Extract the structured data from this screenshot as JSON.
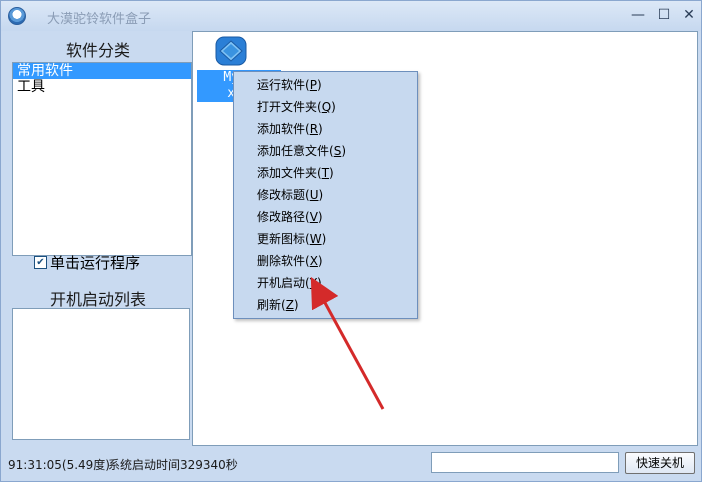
{
  "window": {
    "title": "大漠驼铃软件盒子"
  },
  "controls": {
    "minimize": "—",
    "maximize": "☐",
    "close": "✕"
  },
  "left": {
    "category_title": "软件分类",
    "categories": [
      {
        "label": "常用软件",
        "selected": true
      },
      {
        "label": "工具",
        "selected": false
      }
    ],
    "single_click_label": "单击运行程序",
    "single_click_checked": true,
    "startup_title": "开机启动列表"
  },
  "desktop_item": {
    "label_line1": "MySo",
    "label_line2": "x.e",
    "icon": "blue-diamond-icon"
  },
  "context_menu": {
    "items": [
      {
        "label": "运行软件(",
        "key": "P",
        "tail": ")"
      },
      {
        "label": "打开文件夹(",
        "key": "Q",
        "tail": ")"
      },
      {
        "label": "添加软件(",
        "key": "R",
        "tail": ")"
      },
      {
        "label": "添加任意文件(",
        "key": "S",
        "tail": ")"
      },
      {
        "label": "添加文件夹(",
        "key": "T",
        "tail": ")"
      },
      {
        "label": "修改标题(",
        "key": "U",
        "tail": ")"
      },
      {
        "label": "修改路径(",
        "key": "V",
        "tail": ")"
      },
      {
        "label": "更新图标(",
        "key": "W",
        "tail": ")"
      },
      {
        "label": "删除软件(",
        "key": "X",
        "tail": ")"
      },
      {
        "label": "开机启动(",
        "key": "Y",
        "tail": ")"
      },
      {
        "label": "刷新(",
        "key": "Z",
        "tail": ")"
      }
    ]
  },
  "status": {
    "time": "91:31:05(5.49度)",
    "uptime": "系统启动时间329340秒",
    "input_value": "",
    "shutdown_label": "快速关机"
  },
  "colors": {
    "accent": "#3399ff",
    "frame": "#c9daf0",
    "arrow": "#d42a2a"
  }
}
